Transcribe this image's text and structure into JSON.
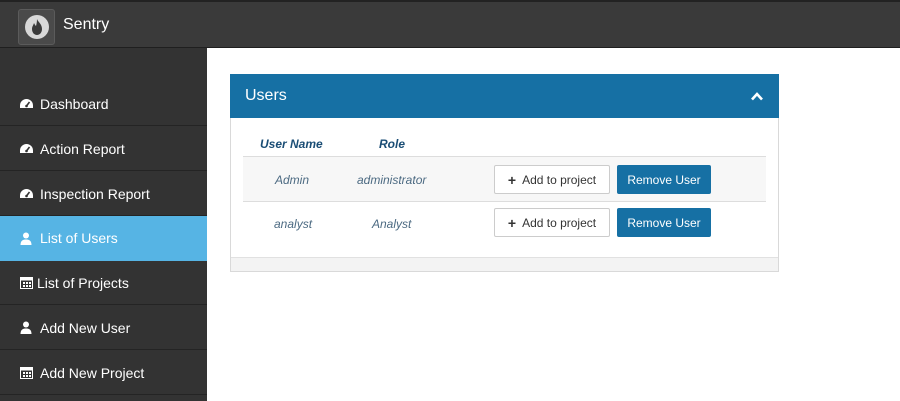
{
  "app": {
    "brand": "Sentry",
    "logo_icon": "fire-logo-icon"
  },
  "colors": {
    "topbar": "#3a3a3a",
    "sidebar": "#333333",
    "active": "#56b4e4",
    "primary": "#1670a4"
  },
  "sidebar": {
    "items": [
      {
        "label": "Dashboard",
        "icon": "tachometer-icon",
        "active": false
      },
      {
        "label": "Action Report",
        "icon": "tachometer-icon",
        "active": false
      },
      {
        "label": "Inspection Report",
        "icon": "tachometer-icon",
        "active": false
      },
      {
        "label": "List of Users",
        "icon": "user-icon",
        "active": true
      },
      {
        "label": "List of Projects",
        "icon": "calendar-icon",
        "active": false
      },
      {
        "label": "Add New User",
        "icon": "user-icon",
        "active": false
      },
      {
        "label": "Add New Project",
        "icon": "calendar-icon",
        "active": false
      }
    ]
  },
  "panel": {
    "title": "Users",
    "collapse_icon": "chevron-up-icon",
    "columns": [
      "User Name",
      "Role"
    ],
    "rows": [
      {
        "user": "Admin",
        "role": "administrator",
        "add_label": "Add to project",
        "remove_label": "Remove User"
      },
      {
        "user": "analyst",
        "role": "Analyst",
        "add_label": "Add to project",
        "remove_label": "Remove User"
      }
    ]
  }
}
